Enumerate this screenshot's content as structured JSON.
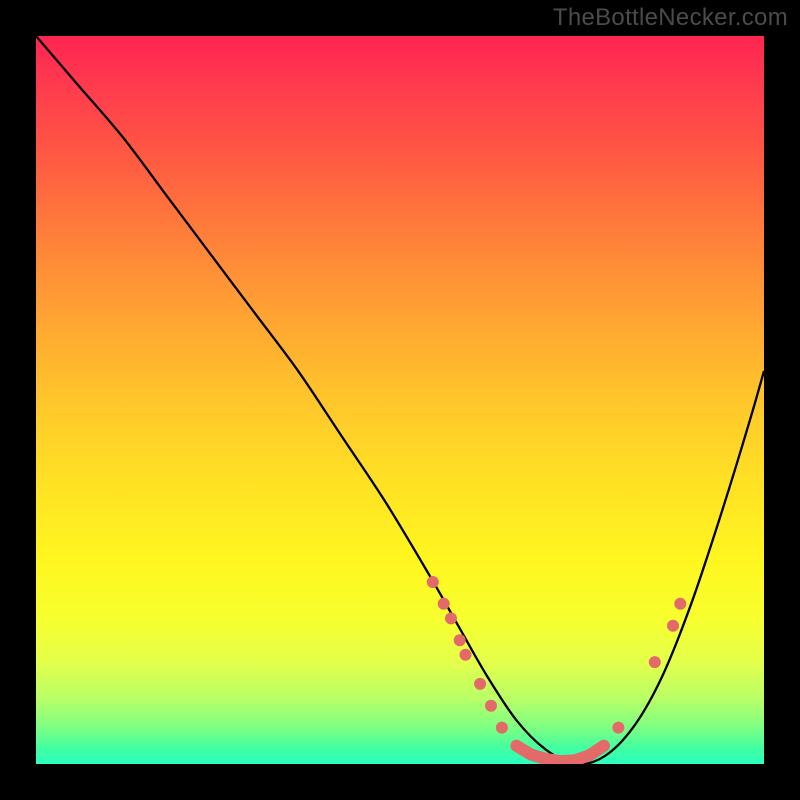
{
  "watermark": "TheBottleNecker.com",
  "chart_data": {
    "type": "line",
    "title": "",
    "xlabel": "",
    "ylabel": "",
    "xlim": [
      0,
      100
    ],
    "ylim": [
      0,
      100
    ],
    "note": "V-shaped bottleneck curve. Plot area is a heatmap-style vertical gradient from red (top, high bottleneck) through orange/yellow to green (bottom, low bottleneck). A black curve traces bottleneck % vs some x-axis parameter; salmon dots mark specific hardware data points clustered near the minimum.",
    "series": [
      {
        "name": "bottleneck-curve",
        "x": [
          0,
          6,
          12,
          18,
          24,
          30,
          36,
          42,
          48,
          54,
          58,
          62,
          66,
          70,
          74,
          78,
          82,
          86,
          90,
          94,
          98,
          100
        ],
        "y": [
          100,
          93,
          86,
          78,
          70,
          62,
          54,
          45,
          36,
          26,
          19,
          12,
          6,
          2,
          0,
          1,
          5,
          12,
          22,
          34,
          47,
          54
        ]
      }
    ],
    "data_points": [
      {
        "x": 54.5,
        "y": 25
      },
      {
        "x": 56.0,
        "y": 22
      },
      {
        "x": 57.0,
        "y": 20
      },
      {
        "x": 58.2,
        "y": 17
      },
      {
        "x": 59.0,
        "y": 15
      },
      {
        "x": 61.0,
        "y": 11
      },
      {
        "x": 62.5,
        "y": 8
      },
      {
        "x": 64.0,
        "y": 5
      },
      {
        "x": 66.0,
        "y": 2.5
      },
      {
        "x": 68.0,
        "y": 1.3
      },
      {
        "x": 70.0,
        "y": 0.7
      },
      {
        "x": 72.0,
        "y": 0.4
      },
      {
        "x": 74.0,
        "y": 0.5
      },
      {
        "x": 76.0,
        "y": 1.2
      },
      {
        "x": 78.0,
        "y": 2.5
      },
      {
        "x": 80.0,
        "y": 5
      },
      {
        "x": 85.0,
        "y": 14
      },
      {
        "x": 87.5,
        "y": 19
      },
      {
        "x": 88.5,
        "y": 22
      }
    ],
    "gradient_stops": [
      {
        "pos": 0,
        "color": "#ff2551"
      },
      {
        "pos": 50,
        "color": "#ffc62b"
      },
      {
        "pos": 80,
        "color": "#f7ff2e"
      },
      {
        "pos": 100,
        "color": "#2bffc0"
      }
    ]
  }
}
